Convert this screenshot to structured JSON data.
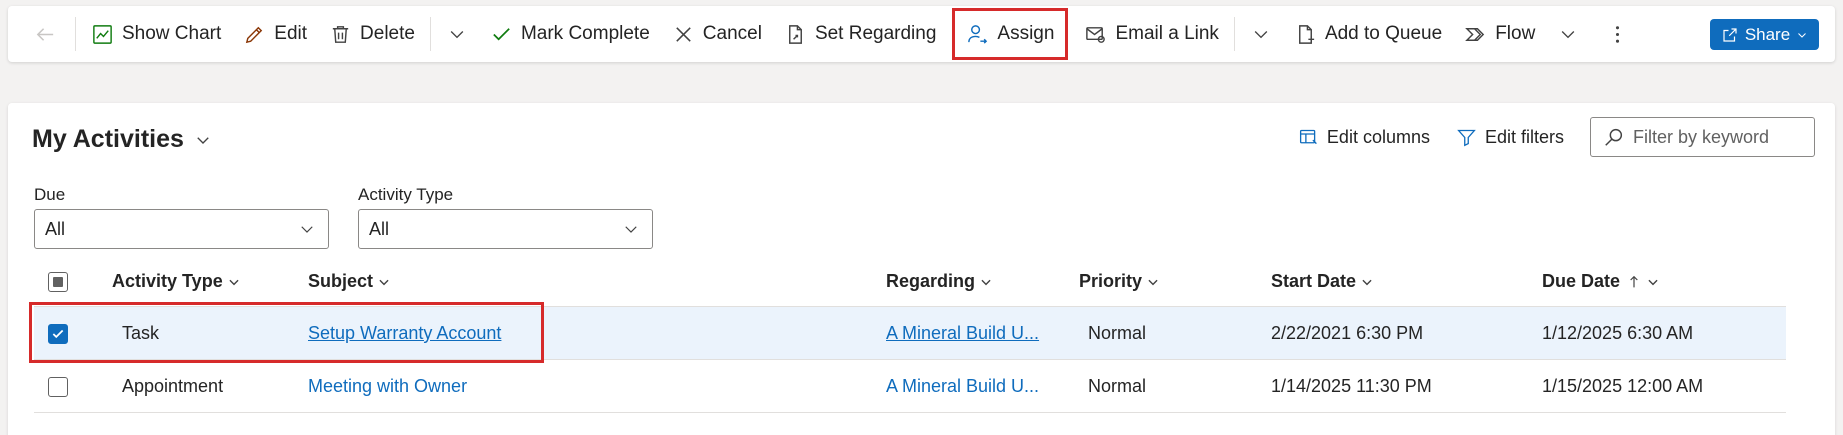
{
  "toolbar": {
    "back_icon": "arrow-left-icon",
    "buttons": [
      {
        "label": "Show Chart",
        "icon": "chart-icon"
      },
      {
        "label": "Edit",
        "icon": "pencil-icon"
      },
      {
        "label": "Delete",
        "icon": "trash-icon"
      },
      {
        "label": "Mark Complete",
        "icon": "checkmark-icon"
      },
      {
        "label": "Cancel",
        "icon": "x-icon"
      },
      {
        "label": "Set Regarding",
        "icon": "document-link-icon"
      },
      {
        "label": "Assign",
        "icon": "person-arrow-icon"
      },
      {
        "label": "Email a Link",
        "icon": "email-link-icon"
      },
      {
        "label": "Add to Queue",
        "icon": "queue-add-icon"
      },
      {
        "label": "Flow",
        "icon": "flow-icon"
      }
    ],
    "share_label": "Share"
  },
  "view": {
    "title": "My Activities",
    "edit_columns": "Edit columns",
    "edit_filters": "Edit filters",
    "search_placeholder": "Filter by keyword"
  },
  "filters": [
    {
      "label": "Due",
      "value": "All"
    },
    {
      "label": "Activity Type",
      "value": "All"
    }
  ],
  "grid": {
    "columns": [
      "Activity Type",
      "Subject",
      "Regarding",
      "Priority",
      "Start Date",
      "Due Date"
    ],
    "sort_column": "Due Date",
    "sort_direction": "ascending",
    "rows": [
      {
        "selected": true,
        "activity_type": "Task",
        "subject": "Setup Warranty Account",
        "regarding": "A Mineral Build U...",
        "priority": "Normal",
        "start_date": "2/22/2021 6:30 PM",
        "due_date": "1/12/2025 6:30 AM"
      },
      {
        "selected": false,
        "activity_type": "Appointment",
        "subject": "Meeting with Owner",
        "regarding": "A Mineral Build U...",
        "priority": "Normal",
        "start_date": "1/14/2025 11:30 PM",
        "due_date": "1/15/2025 12:00 AM"
      }
    ]
  },
  "colors": {
    "accent": "#0f6cbd",
    "highlight": "#d62a2a",
    "selected_row": "#ebf3fc"
  }
}
